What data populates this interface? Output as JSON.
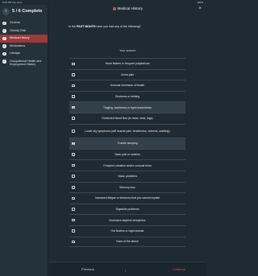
{
  "status_bar": {
    "time": "8:25 PM  Tue Jul 8",
    "battery": "100%"
  },
  "sidebar": {
    "progress_title": "5 / 6 Complete",
    "items": [
      {
        "label": "General",
        "done": true
      },
      {
        "label": "Obesity Risk",
        "done": true
      },
      {
        "label": "Medical History",
        "done": true,
        "active": true
      },
      {
        "label": "Medications",
        "done": true
      },
      {
        "label": "Lifestyle",
        "done": true
      },
      {
        "label": "Occupational Health and Employment History",
        "done": true
      }
    ]
  },
  "header": {
    "title": "Medical History"
  },
  "question": {
    "prefix": "In the ",
    "emphasis": "PAST MONTH",
    "suffix": " have you had any of the following?"
  },
  "subheading": "Your answer:",
  "options": [
    {
      "label": "Heart flutters or frequent palpitations",
      "checked": false
    },
    {
      "label": "Chest pain",
      "checked": false
    },
    {
      "label": "Unusual shortness of breath",
      "checked": false
    },
    {
      "label": "Dizziness or fainting",
      "checked": false
    },
    {
      "label": "Tingling, numbness or light-headedness",
      "checked": true
    },
    {
      "label": "Restricted blood flow (to head, neck, legs)",
      "checked": false
    },
    {
      "label": "Lower leg symptoms (calf muscle pain, tenderness, redness, swelling)",
      "checked": false
    },
    {
      "label": "Trouble sleeping",
      "checked": true
    },
    {
      "label": "Back pain or sciatica",
      "checked": false
    },
    {
      "label": "Frequent urination and/or unusual thirst",
      "checked": false
    },
    {
      "label": "Vision problems",
      "checked": false
    },
    {
      "label": "Memory loss",
      "checked": false
    },
    {
      "label": "Increased fatigue or tiredness that you cannot explain",
      "checked": false
    },
    {
      "label": "Digestive problems",
      "checked": false
    },
    {
      "label": "Excessive daytime sleepiness",
      "checked": false
    },
    {
      "label": "Hot flushes or night sweats",
      "checked": false
    },
    {
      "label": "None of the above",
      "checked": false
    }
  ],
  "footer": {
    "previous_label": "Previous",
    "separator": "|",
    "continue_label": "Continue"
  },
  "colors": {
    "accent": "#9b3a3a",
    "continue": "#e0524f",
    "background": "#1e2b33"
  }
}
